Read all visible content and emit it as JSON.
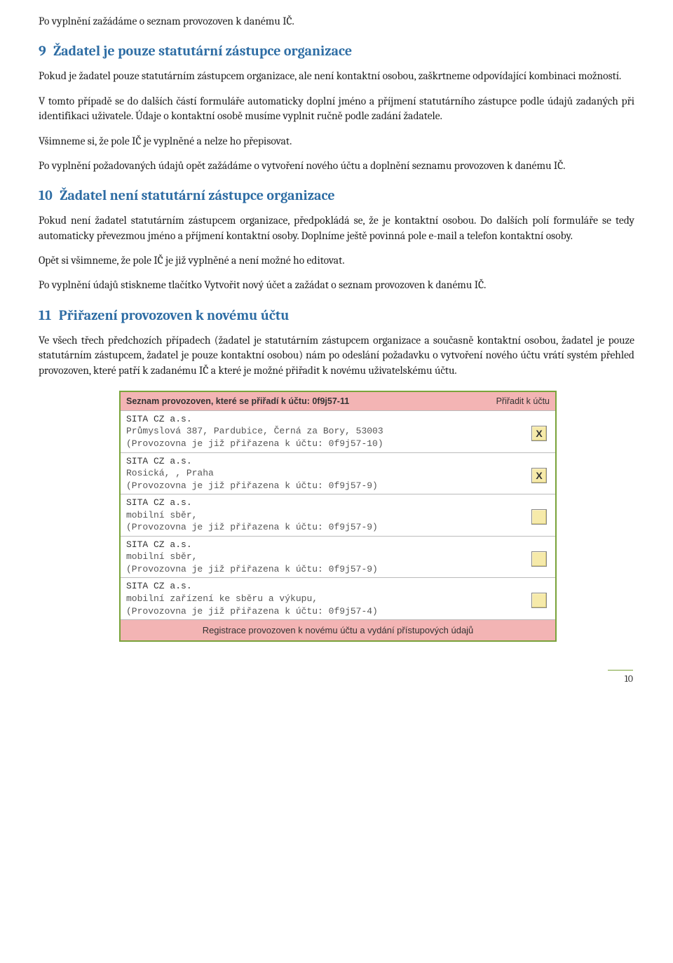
{
  "intro_p": "Po vyplnění zažádáme o seznam provozoven k danému IČ.",
  "sec9": {
    "num": "9",
    "title": "Žadatel je pouze statutární zástupce organizace",
    "p1": "Pokud je žadatel pouze statutárním zástupcem organizace, ale není kontaktní osobou, zaškrtneme odpovídající kombinaci možností.",
    "p2": "V tomto případě se do dalších částí formuláře automaticky doplní jméno a příjmení statutárního zástupce podle údajů zadaných při identifikaci uživatele. Údaje o kontaktní osobě musíme vyplnit ručně podle zadání žadatele.",
    "p3": "Všimneme si, že pole IČ je vyplněné a nelze ho přepisovat.",
    "p4": "Po vyplnění požadovaných údajů opět zažádáme o vytvoření nového účtu a doplnění seznamu provozoven k danému IČ."
  },
  "sec10": {
    "num": "10",
    "title": "Žadatel není statutární zástupce organizace",
    "p1": "Pokud není žadatel statutárním zástupcem organizace, předpokládá se, že je kontaktní osobou. Do dalších polí formuláře se tedy automaticky převezmou jméno a příjmení kontaktní osoby. Doplníme ještě povinná pole e-mail a telefon kontaktní osoby.",
    "p2": "Opět si všimneme, že pole IČ je již vyplněné a není možné ho editovat.",
    "p3": "Po vyplnění údajů stiskneme tlačítko Vytvořit nový účet a zažádat o seznam provozoven k danému IČ."
  },
  "sec11": {
    "num": "11",
    "title": "Přiřazení provozoven k novému účtu",
    "p1": "Ve všech třech předchozích případech (žadatel je statutárním zástupcem organizace a současně kontaktní osobou, žadatel je pouze statutárním zástupcem, žadatel je pouze kontaktní osobou) nám po odeslání požadavku o vytvoření nového účtu vrátí systém přehled provozoven, které patří k zadanému IČ a které je možné přiřadit k novému uživatelskému účtu."
  },
  "table": {
    "title": "Seznam provozoven, které se přiřadí k účtu: 0f9j57-11",
    "col_right": "Přiřadit k účtu",
    "footer": "Registrace provozoven k novému účtu a vydání přístupových údajů",
    "rows": [
      {
        "company": "SITA CZ a.s.",
        "addr": "Průmyslová 387, Pardubice, Černá za Bory, 53003",
        "note": "(Provozovna je již přiřazena k účtu: 0f9j57-10)",
        "checked": true
      },
      {
        "company": "SITA CZ a.s.",
        "addr": "Rosická, , Praha",
        "note": "(Provozovna je již přiřazena k účtu: 0f9j57-9)",
        "checked": true
      },
      {
        "company": "SITA CZ a.s.",
        "addr": "mobilní sběr,",
        "note": "(Provozovna je již přiřazena k účtu: 0f9j57-9)",
        "checked": false
      },
      {
        "company": "SITA CZ a.s.",
        "addr": "mobilní sběr,",
        "note": "(Provozovna je již přiřazena k účtu: 0f9j57-9)",
        "checked": false
      },
      {
        "company": "SITA CZ a.s.",
        "addr": "mobilní zařízení ke sběru a výkupu,",
        "note": "(Provozovna je již přiřazena k účtu: 0f9j57-4)",
        "checked": false
      }
    ]
  },
  "page_number": "10"
}
